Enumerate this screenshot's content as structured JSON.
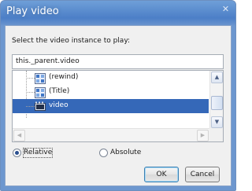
{
  "window": {
    "title": "Play video",
    "close_glyph": "✕"
  },
  "instruction": "Select the video instance to play:",
  "path_field": {
    "value": "this._parent.video"
  },
  "tree": {
    "items": [
      {
        "label": "(rewind)",
        "icon": "movieclip-icon",
        "selected": false
      },
      {
        "label": "(Title)",
        "icon": "movieclip-icon",
        "selected": false
      },
      {
        "label": "video",
        "icon": "video-icon",
        "selected": true
      }
    ],
    "scroll_up_glyph": "▲",
    "scroll_down_glyph": "▼",
    "scroll_left_glyph": "◀",
    "scroll_right_glyph": "▶"
  },
  "options": {
    "relative_label": "Relative",
    "absolute_label": "Absolute",
    "selected": "relative"
  },
  "buttons": {
    "ok_label": "OK",
    "cancel_label": "Cancel"
  },
  "colors": {
    "title_bar": "#4c7fc7",
    "selection": "#3568b8",
    "dialog_bg": "#f0f0f0"
  }
}
